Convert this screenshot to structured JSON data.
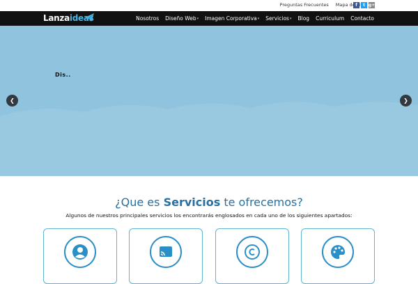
{
  "topbar": {
    "links": [
      "Preguntas Frecuentes",
      "Mapa de Sitio"
    ],
    "social": [
      {
        "icon": "facebook-icon",
        "glyph": "f",
        "color": "#3b5998"
      },
      {
        "icon": "twitter-icon",
        "glyph": "t",
        "color": "#1da1f2"
      },
      {
        "icon": "googleplus-icon",
        "glyph": "g+",
        "color": "#888888"
      }
    ]
  },
  "nav": {
    "logo_part1": "Lanza",
    "logo_part2": "ideas",
    "items": [
      {
        "label": "Nosotros",
        "dropdown": false
      },
      {
        "label": "Diseño Web",
        "dropdown": true
      },
      {
        "label": "Imagen Corporativa",
        "dropdown": true
      },
      {
        "label": "Servicios",
        "dropdown": true
      },
      {
        "label": "Blog",
        "dropdown": false
      },
      {
        "label": "Curriculum",
        "dropdown": false
      },
      {
        "label": "Contacto",
        "dropdown": false
      }
    ]
  },
  "hero": {
    "caption": "Dis..",
    "prev_glyph": "❮",
    "next_glyph": "❯",
    "bg_color": "#90c3de"
  },
  "services": {
    "title_pre": "¿Que es ",
    "title_bold": "Servicios",
    "title_post": " te ofrecemos?",
    "subtitle": "Algunos de nuestros principales servicios los encontrarás englosados en cada uno de los siguientes apartados:",
    "cards": [
      {
        "icon": "user-icon"
      },
      {
        "icon": "cast-icon"
      },
      {
        "icon": "copyright-icon"
      },
      {
        "icon": "palette-icon"
      }
    ],
    "accent_color": "#2a8fc7"
  }
}
